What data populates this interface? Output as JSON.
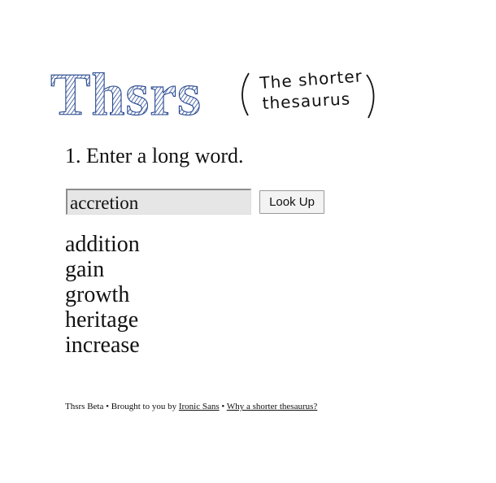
{
  "header": {
    "logo_text": "Thsrs",
    "tagline_line1": "The shorter",
    "tagline_line2": "thesaurus"
  },
  "colors": {
    "logo_blue": "#2f4f9a",
    "tagline_ink": "#111111",
    "input_bg": "#e6e6e6"
  },
  "form": {
    "step_label": "1. Enter a long word.",
    "word_value": "accretion",
    "submit_label": "Look Up"
  },
  "results": [
    "addition",
    "gain",
    "growth",
    "heritage",
    "increase"
  ],
  "footer": {
    "beta_text": "Thsrs Beta",
    "separator": "•",
    "brought_text": "Brought to you by",
    "ironic_sans_link": "Ironic Sans",
    "why_link": "Why a shorter thesaurus?"
  }
}
